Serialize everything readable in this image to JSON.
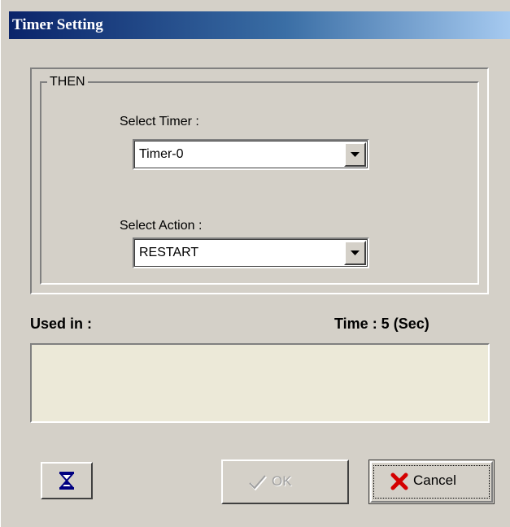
{
  "window": {
    "title": "Timer Setting"
  },
  "then_group": {
    "legend": "THEN",
    "select_timer_label": "Select Timer :",
    "timer_value": "Timer-0",
    "select_action_label": "Select Action :",
    "action_value": "RESTART"
  },
  "info": {
    "used_in_label": "Used in :",
    "time_label": "Time :  5  (Sec)"
  },
  "buttons": {
    "hourglass_icon": "hourglass-icon",
    "ok_label": "OK",
    "ok_icon": "checkmark-icon",
    "cancel_label": "Cancel",
    "cancel_icon": "red-x-icon"
  },
  "colors": {
    "titlebar_start": "#0a246a",
    "titlebar_end": "#a6caf0",
    "face": "#d4d0c8",
    "list_bg": "#ece9d8",
    "cancel_x": "#d40000"
  }
}
